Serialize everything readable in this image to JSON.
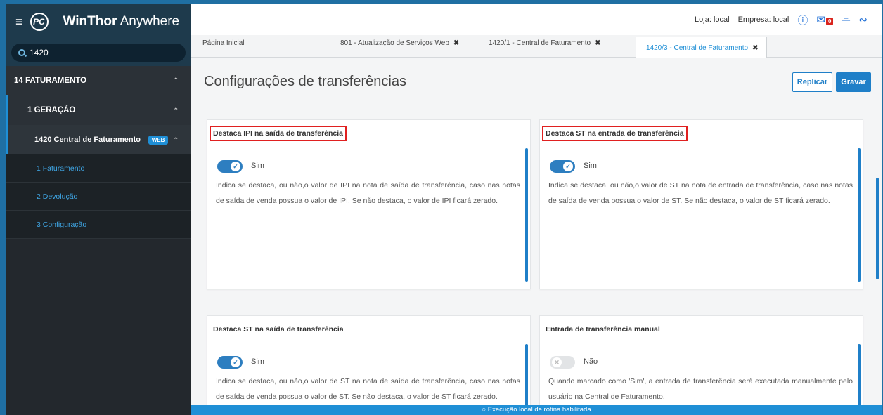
{
  "app": {
    "brand_logo": "PC",
    "title_bold": "WinThor",
    "title_rest": " Anywhere"
  },
  "search": {
    "value": "1420"
  },
  "sidebar": {
    "level1": {
      "label": "14  FATURAMENTO"
    },
    "level2": {
      "label": "1  GERAÇÃO"
    },
    "level3": {
      "label": "1420  Central de Faturamento",
      "badge": "WEB"
    },
    "items": [
      {
        "label": "1  Faturamento"
      },
      {
        "label": "2  Devolução"
      },
      {
        "label": "3  Configuração"
      }
    ]
  },
  "header": {
    "loja": "Loja: local",
    "empresa": "Empresa: local",
    "mail_count": "0",
    "icons": [
      "help-icon",
      "mail-icon",
      "bell-icon",
      "user-icon"
    ]
  },
  "tabs": [
    {
      "label": "Página Inicial"
    },
    {
      "label": "801 - Atualização de Serviços Web"
    },
    {
      "label": "1420/1 - Central de Faturamento"
    },
    {
      "label": "1420/3 - Central de Faturamento"
    }
  ],
  "page": {
    "title": "Configurações de transferências",
    "replicar": "Replicar",
    "gravar": "Gravar"
  },
  "cards": [
    {
      "title": "Destaca IPI na saída de transferência",
      "toggle": "Sim",
      "desc": "Indica se destaca, ou não,o valor de IPI na nota de saída de transferência, caso nas notas de saída de venda possua o valor de IPI. Se não destaca, o valor de IPI ficará zerado."
    },
    {
      "title": "Destaca ST na entrada de transferência",
      "toggle": "Sim",
      "desc": "Indica se destaca, ou não,o valor de ST na nota de entrada de transferência, caso nas notas de saída de venda possua o valor de ST. Se não destaca, o valor de ST ficará zerado."
    },
    {
      "title": "Destaca ST na saída de transferência",
      "toggle": "Sim",
      "desc": "Indica se destaca, ou não,o valor de ST na nota de saída de transferência, caso nas notas de saída de venda possua o valor de ST. Se não destaca, o valor de ST ficará zerado."
    },
    {
      "title": "Entrada de transferência manual",
      "toggle": "Não",
      "desc": "Quando marcado como 'Sim', a entrada de transferência será executada manualmente pelo usuário na Central de Faturamento."
    }
  ],
  "footer": {
    "text": "Execução local de rotina habilitada"
  },
  "colors": {
    "accent": "#1f7fc8",
    "highlight": "#e02020",
    "sidebar": "#23282d"
  }
}
